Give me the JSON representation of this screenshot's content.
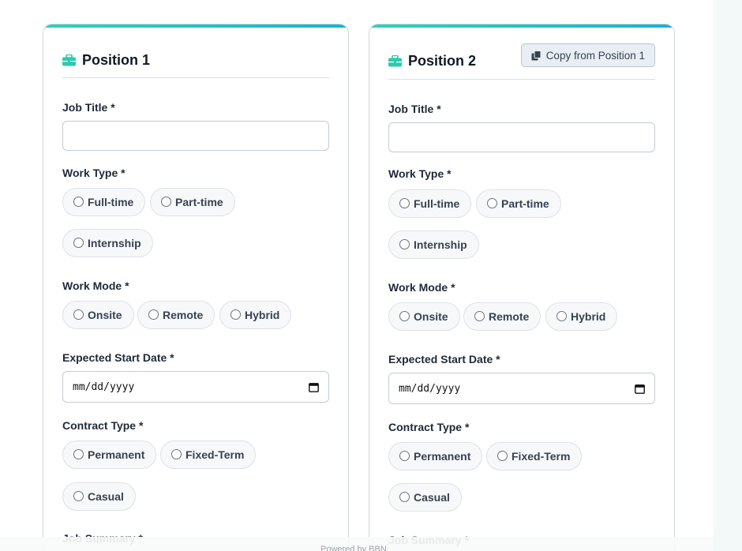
{
  "positions": [
    {
      "title": "Position 1",
      "labels": {
        "job_title": "Job Title *",
        "work_type": "Work Type *",
        "work_mode": "Work Mode *",
        "start_date": "Expected Start Date *",
        "contract_type": "Contract Type *",
        "job_summary": "Job Summary *"
      },
      "date_placeholder": "mm/dd/yyyy",
      "work_type_options": [
        "Full-time",
        "Part-time",
        "Internship"
      ],
      "work_mode_options": [
        "Onsite",
        "Remote",
        "Hybrid"
      ],
      "contract_type_options": [
        "Permanent",
        "Fixed-Term",
        "Casual"
      ]
    },
    {
      "title": "Position 2",
      "copy_button_label": "Copy from Position 1",
      "labels": {
        "job_title": "Job Title *",
        "work_type": "Work Type *",
        "work_mode": "Work Mode *",
        "start_date": "Expected Start Date *",
        "contract_type": "Contract Type *",
        "job_summary": "Job Summary *"
      },
      "date_placeholder": "mm/dd/yyyy",
      "work_type_options": [
        "Full-time",
        "Part-time",
        "Internship"
      ],
      "work_mode_options": [
        "Onsite",
        "Remote",
        "Hybrid"
      ],
      "contract_type_options": [
        "Permanent",
        "Fixed-Term",
        "Casual"
      ]
    }
  ],
  "footer": {
    "text": "Powered by BBN"
  },
  "colors": {
    "accent_teal": "#2fd3b6",
    "accent_blue": "#18b3d6"
  },
  "icons": {
    "card_icon": "briefcase-icon",
    "copy_icon": "copy-icon",
    "date_icon": "calendar-icon"
  }
}
